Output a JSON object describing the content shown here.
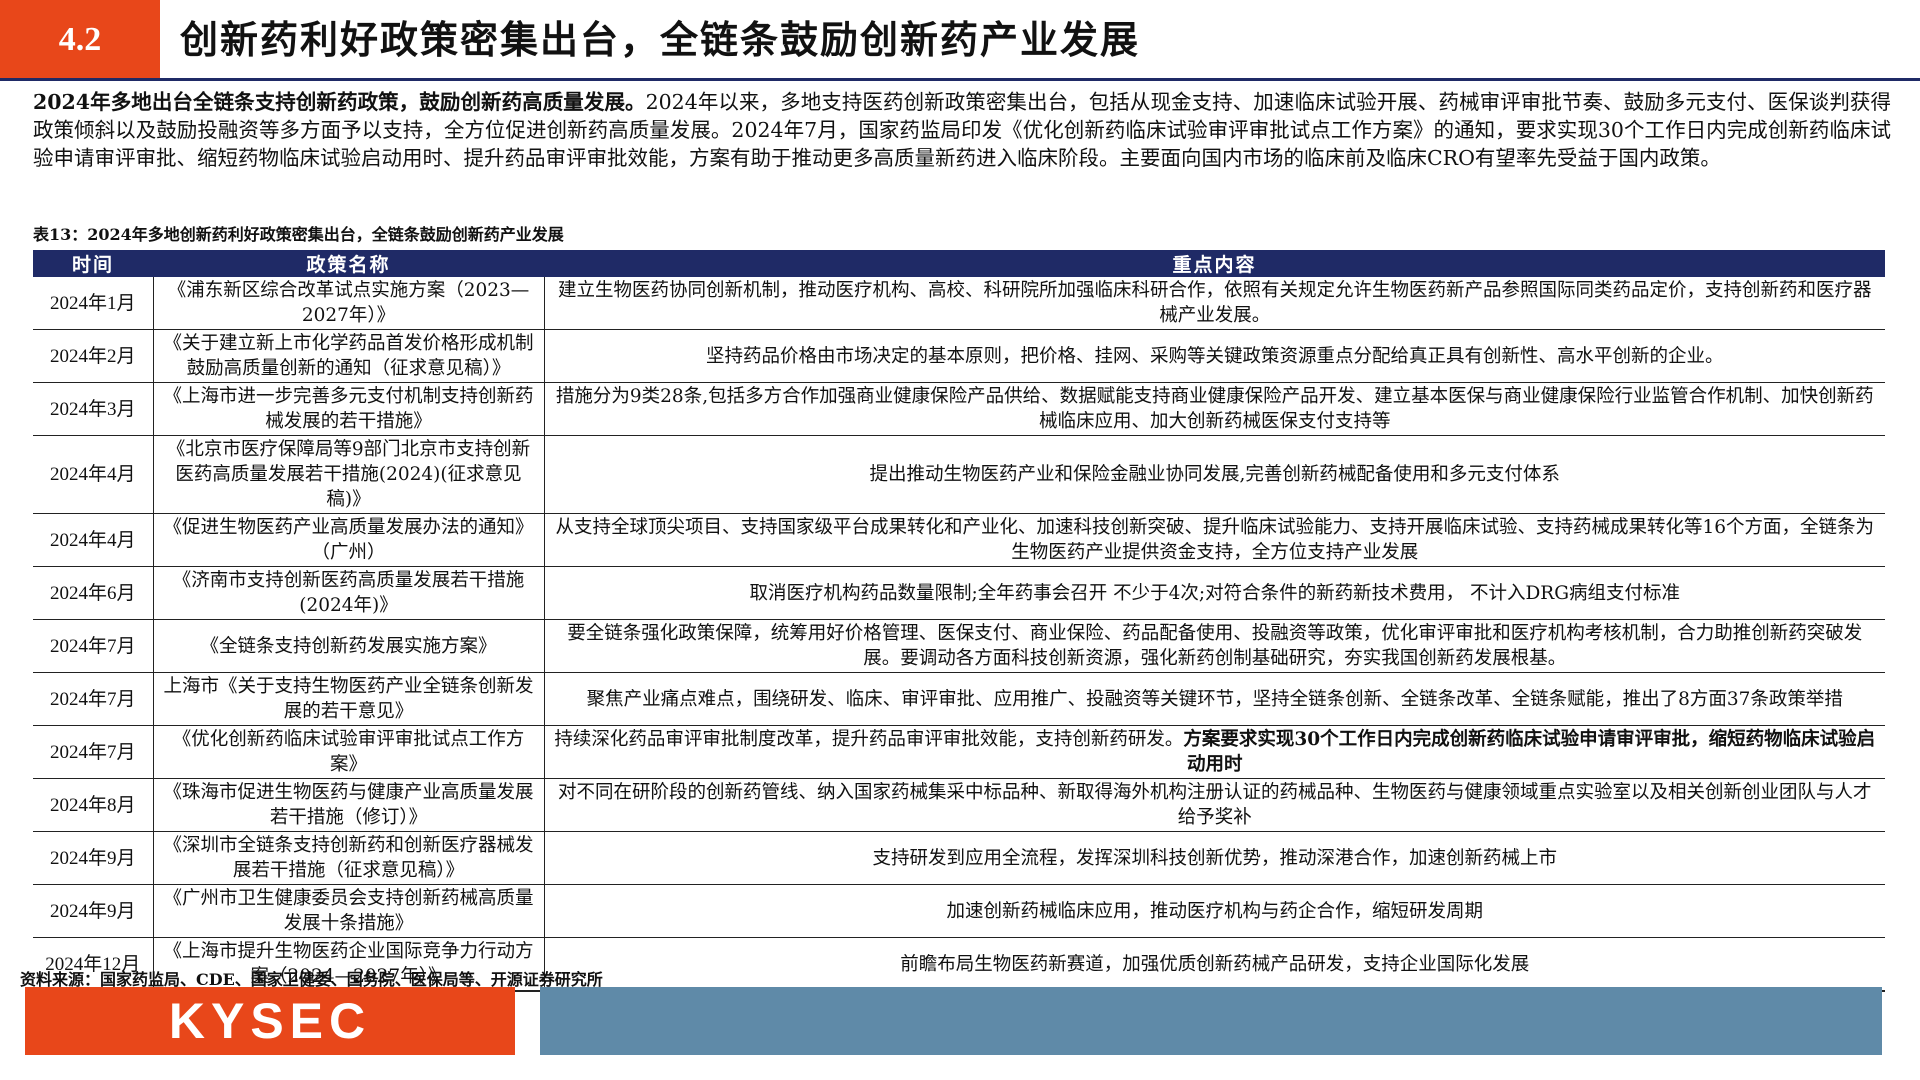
{
  "header": {
    "section_number": "4.2",
    "title": "创新药利好政策密集出台，全链条鼓励创新药产业发展"
  },
  "intro": {
    "lead": "2024年多地出台全链条支持创新药政策，鼓励创新药高质量发展。",
    "body": "2024年以来，多地支持医药创新政策密集出台，包括从现金支持、加速临床试验开展、药械审评审批节奏、鼓励多元支付、医保谈判获得政策倾斜以及鼓励投融资等多方面予以支持，全方位促进创新药高质量发展。2024年7月，国家药监局印发《优化创新药临床试验审评审批试点工作方案》的通知，要求实现30个工作日内完成创新药临床试验申请审评审批、缩短药物临床试验启动用时、提升药品审评审批效能，方案有助于推动更多高质量新药进入临床阶段。主要面向国内市场的临床前及临床CRO有望率先受益于国内政策。"
  },
  "table": {
    "caption": "表13：2024年多地创新药利好政策密集出台，全链条鼓励创新药产业发展",
    "headers": [
      "时间",
      "政策名称",
      "重点内容"
    ],
    "rows": [
      {
        "time": "2024年1月",
        "name": "《浦东新区综合改革试点实施方案（2023—2027年）》",
        "content": "建立生物医药协同创新机制，推动医疗机构、高校、科研院所加强临床科研合作，依照有关规定允许生物医药新产品参照国际同类药品定价，支持创新药和医疗器械产业发展。",
        "content_bold": ""
      },
      {
        "time": "2024年2月",
        "name": "《关于建立新上市化学药品首发价格形成机制鼓励高质量创新的通知（征求意见稿）》",
        "content": "坚持药品价格由市场决定的基本原则，把价格、挂网、采购等关键政策资源重点分配给真正具有创新性、高水平创新的企业。",
        "content_bold": ""
      },
      {
        "time": "2024年3月",
        "name": "《上海市进一步完善多元支付机制支持创新药械发展的若干措施》",
        "content": "措施分为9类28条,包括多方合作加强商业健康保险产品供给、数据赋能支持商业健康保险产品开发、建立基本医保与商业健康保险行业监管合作机制、加快创新药械临床应用、加大创新药械医保支付支持等",
        "content_bold": ""
      },
      {
        "time": "2024年4月",
        "name": "《北京市医疗保障局等9部门北京市支持创新医药高质量发展若干措施(2024)(征求意见稿)》",
        "content": "提出推动生物医药产业和保险金融业协同发展,完善创新药械配备使用和多元支付体系",
        "content_bold": ""
      },
      {
        "time": "2024年4月",
        "name": "《促进生物医药产业高质量发展办法的通知》（广州）",
        "content": "从支持全球顶尖项目、支持国家级平台成果转化和产业化、加速科技创新突破、提升临床试验能力、支持开展临床试验、支持药械成果转化等16个方面，全链条为生物医药产业提供资金支持，全方位支持产业发展",
        "content_bold": ""
      },
      {
        "time": "2024年6月",
        "name": "《济南市支持创新医药高质量发展若干措施(2024年)》",
        "content": "取消医疗机构药品数量限制;全年药事会召开 不少于4次;对符合条件的新药新技术费用， 不计入DRG病组支付标准",
        "content_bold": ""
      },
      {
        "time": "2024年7月",
        "name": "《全链条支持创新药发展实施方案》",
        "content": "要全链条强化政策保障，统筹用好价格管理、医保支付、商业保险、药品配备使用、投融资等政策，优化审评审批和医疗机构考核机制，合力助推创新药突破发展。要调动各方面科技创新资源，强化新药创制基础研究，夯实我国创新药发展根基。",
        "content_bold": ""
      },
      {
        "time": "2024年7月",
        "name": "上海市《关于支持生物医药产业全链条创新发展的若干意见》",
        "content": "聚焦产业痛点难点，围绕研发、临床、审评审批、应用推广、投融资等关键环节，坚持全链条创新、全链条改革、全链条赋能，推出了8方面37条政策举措",
        "content_bold": ""
      },
      {
        "time": "2024年7月",
        "name": "《优化创新药临床试验审评审批试点工作方案》",
        "content": "持续深化药品审评审批制度改革，提升药品审评审批效能，支持创新药研发。",
        "content_bold": "方案要求实现30个工作日内完成创新药临床试验申请审评审批，缩短药物临床试验启动用时"
      },
      {
        "time": "2024年8月",
        "name": "《珠海市促进生物医药与健康产业高质量发展若干措施（修订）》",
        "content": "对不同在研阶段的创新药管线、纳入国家药械集采中标品种、新取得海外机构注册认证的药械品种、生物医药与健康领域重点实验室以及相关创新创业团队与人才给予奖补",
        "content_bold": ""
      },
      {
        "time": "2024年9月",
        "name": "《深圳市全链条支持创新药和创新医疗器械发展若干措施（征求意见稿）》",
        "content": "支持研发到应用全流程，发挥深圳科技创新优势，推动深港合作，加速创新药械上市",
        "content_bold": ""
      },
      {
        "time": "2024年9月",
        "name": "《广州市卫生健康委员会支持创新药械高质量发展十条措施》",
        "content": "加速创新药械临床应用，推动医疗机构与药企合作，缩短研发周期",
        "content_bold": ""
      },
      {
        "time": "2024年12月",
        "name": "《上海市提升生物医药企业国际竞争力行动方案（2024—2027年）》",
        "content": "前瞻布局生物医药新赛道，加强优质创新药械产品研发，支持企业国际化发展",
        "content_bold": ""
      }
    ]
  },
  "source": "资料来源：国家药监局、CDE、国家卫健委、国务院、医保局等、开源证券研究所",
  "footer": {
    "logo_text": "KYSEC",
    "brand_color": "#e8471a",
    "bar_color": "#5f8aa8"
  }
}
